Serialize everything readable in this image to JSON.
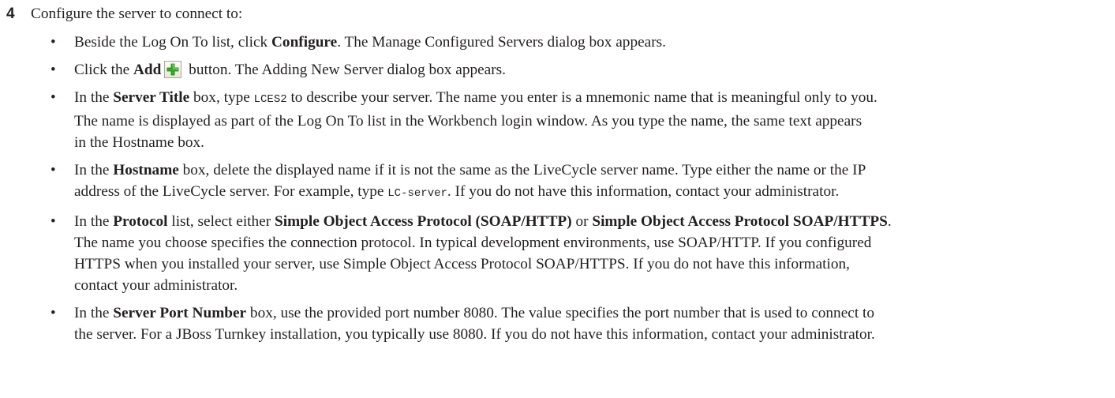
{
  "step": {
    "number": "4",
    "text": "Configure the server to connect to:"
  },
  "bullets": {
    "b1": {
      "p1": "Beside the Log On To list, click ",
      "b1": "Configure",
      "p2": ". The Manage Configured Servers dialog box appears."
    },
    "b2": {
      "p1": "Click the ",
      "b1": "Add",
      "p2": " button. The Adding New Server dialog box appears."
    },
    "b3": {
      "p1": "In the ",
      "b1": "Server Title",
      "p2": " box, type ",
      "code1": "LCES2",
      "p3": " to describe your server. The name you enter is a mnemonic name that is meaningful only to you.",
      "l2": "The name is displayed as part of the Log On To list in the Workbench login window. As you type the name, the same text appears",
      "l3": "in the Hostname box."
    },
    "b4": {
      "p1": "In the ",
      "b1": "Hostname",
      "p2": " box, delete the displayed name if it is not the same as the LiveCycle server name. Type either the name or the IP",
      "l2p1": "address of the LiveCycle server. For example, type ",
      "code1": "LC-server",
      "l2p2": ". If you do not have this information, contact your administrator."
    },
    "b5": {
      "p1": "In the ",
      "b1": "Protocol",
      "p2": " list, select either ",
      "b2": "Simple Object Access Protocol (SOAP/HTTP)",
      "p3": " or ",
      "b3": "Simple Object Access Protocol SOAP/HTTPS",
      "p4": ".",
      "l2": "The name you choose specifies the connection protocol. In typical development environments, use SOAP/HTTP. If you configured",
      "l3": "HTTPS when you installed your server, use Simple Object Access Protocol SOAP/HTTPS. If you do not have this information,",
      "l4": "contact your administrator."
    },
    "b6": {
      "p1": "In the ",
      "b1": "Server Port Number",
      "p2": " box, use the provided port number 8080. The value specifies the port number that is used to connect to",
      "l2": "the server. For a JBoss Turnkey installation, you typically use 8080. If you do not have this information, contact your administrator."
    }
  },
  "icons": {
    "add_icon": "plus-icon",
    "add_icon_color": "#3aa829"
  }
}
